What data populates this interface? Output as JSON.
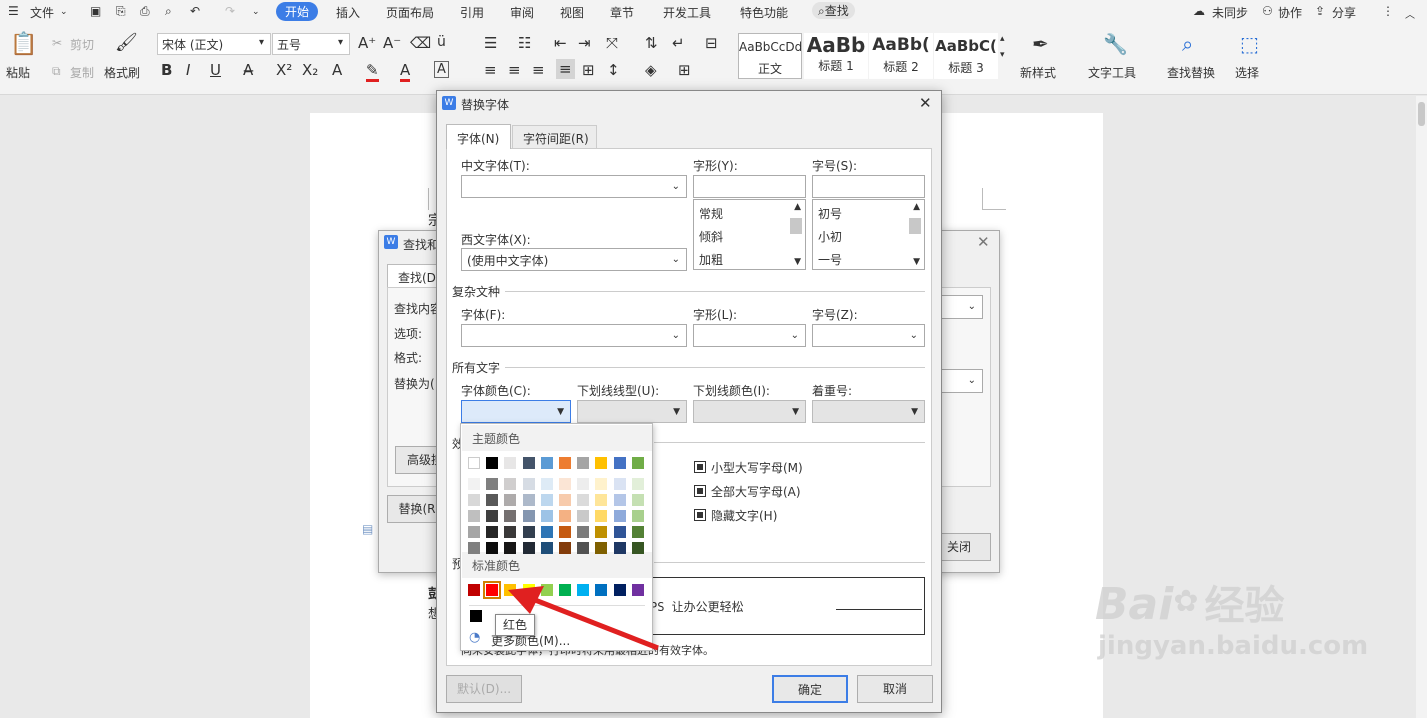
{
  "menu": {
    "file": "文件",
    "tabs": [
      "开始",
      "插入",
      "页面布局",
      "引用",
      "审阅",
      "视图",
      "章节",
      "开发工具",
      "特色功能"
    ],
    "search": "查找",
    "right": [
      "未同步",
      "协作",
      "分享"
    ]
  },
  "ribbon": {
    "paste": "粘贴",
    "cut": "剪切",
    "copy": "复制",
    "format_painter": "格式刷",
    "font_name": "宋体 (正文)",
    "font_size": "五号",
    "styles": [
      {
        "sample": "AaBbCcDd",
        "label": "正文"
      },
      {
        "sample": "AaBb",
        "label": "标题 1"
      },
      {
        "sample": "AaBb(",
        "label": "标题 2"
      },
      {
        "sample": "AaBbC(",
        "label": "标题 3"
      }
    ],
    "new_style": "新样式",
    "text_tools": "文字工具",
    "find_replace": "查找替换",
    "select": "选择"
  },
  "find_dialog": {
    "title": "查找和",
    "tab": "查找(D",
    "find_content": "查找内容",
    "options": "选项:",
    "format": "格式:",
    "replace_with": "替换为(",
    "advanced": "高级搜",
    "replace_btn": "替换(R",
    "close_btn": "关闭"
  },
  "font_dialog": {
    "title": "替换字体",
    "tabs": [
      "字体(N)",
      "字符间距(R)"
    ],
    "cn_font": "中文字体(T):",
    "style": "字形(Y):",
    "size": "字号(S):",
    "west_font": "西文字体(X):",
    "west_font_value": "(使用中文字体)",
    "style_list": [
      "常规",
      "倾斜",
      "加粗"
    ],
    "size_list": [
      "初号",
      "小初",
      "一号"
    ],
    "complex_group": "复杂文种",
    "complex_font": "字体(F):",
    "complex_style": "字形(L):",
    "complex_size": "字号(Z):",
    "all_text_group": "所有文字",
    "font_color": "字体颜色(C):",
    "underline_type": "下划线线型(U):",
    "underline_color": "下划线颜色(I):",
    "emphasis": "着重号:",
    "effects_group": "效",
    "small_caps": "小型大写字母(M)",
    "all_caps": "全部大写字母(A)",
    "hidden": "隐藏文字(H)",
    "preview_group": "预",
    "preview_text": "PS 让办公更轻松",
    "hint": "同未安装此字体，打印时将采用最相近的有效字体。",
    "default_btn": "默认(D)...",
    "ok_btn": "确定",
    "cancel_btn": "取消"
  },
  "color_popup": {
    "theme_label": "主题颜色",
    "theme_top": [
      "#ffffff",
      "#000000",
      "#e7e6e6",
      "#44546a",
      "#5b9bd5",
      "#ed7d31",
      "#a5a5a5",
      "#ffc000",
      "#4472c4",
      "#70ad47"
    ],
    "theme_shades": [
      [
        "#f2f2f2",
        "#7f7f7f",
        "#d0cece",
        "#d6dce4",
        "#deebf6",
        "#fbe5d5",
        "#ededed",
        "#fff2cc",
        "#dae3f3",
        "#e2efd9"
      ],
      [
        "#d8d8d8",
        "#595959",
        "#aeabab",
        "#adb9ca",
        "#bdd7ee",
        "#f7cbac",
        "#dbdbdb",
        "#fee599",
        "#b4c6e7",
        "#c5e0b3"
      ],
      [
        "#bfbfbf",
        "#3f3f3f",
        "#757070",
        "#8496b0",
        "#9dc3e6",
        "#f4b183",
        "#c9c9c9",
        "#ffd965",
        "#8eaadb",
        "#a8d08d"
      ],
      [
        "#a5a5a5",
        "#262626",
        "#3a3838",
        "#323f4f",
        "#2e75b5",
        "#c55a11",
        "#7b7b7b",
        "#bf9000",
        "#2f5496",
        "#538135"
      ],
      [
        "#7f7f7f",
        "#0c0c0c",
        "#171616",
        "#222a35",
        "#1f4e79",
        "#833c0b",
        "#525252",
        "#7f6000",
        "#1f3864",
        "#375623"
      ]
    ],
    "standard_label": "标准颜色",
    "standard": [
      "#c00000",
      "#ff0000",
      "#ffc000",
      "#ffff00",
      "#92d050",
      "#00b050",
      "#00b0f0",
      "#0070c0",
      "#002060",
      "#7030a0"
    ],
    "tooltip": "红色",
    "more_colors": "更多颜色(M)..."
  },
  "watermark": {
    "brand": "Bai",
    "brand2": "经验",
    "url": "jingyan.baidu.com"
  }
}
